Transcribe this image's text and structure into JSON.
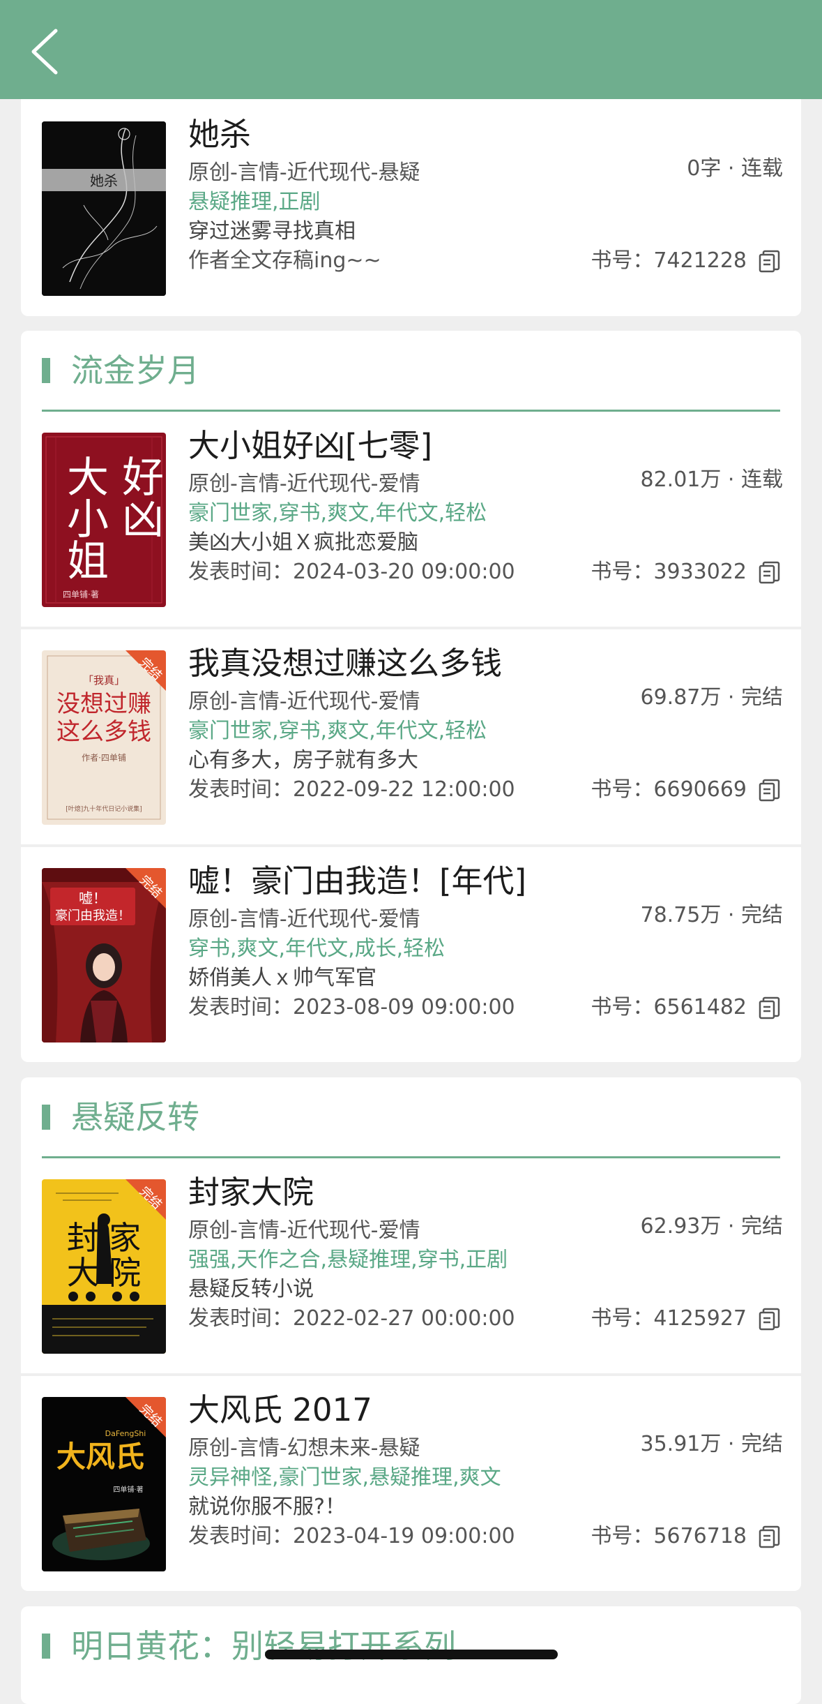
{
  "header": {
    "title": "",
    "back_icon": "chevron-left-icon",
    "bg_color": "#6fae8e"
  },
  "top_book": {
    "title": "她杀",
    "cover_text": "她杀",
    "category": "原创-言情-近代现代-悬疑",
    "meta": "0字 · 连载",
    "tags": "悬疑推理,正剧",
    "intro": "穿过迷雾寻找真相",
    "time": "作者全文存稿ing~~",
    "book_id": "书号：7421228"
  },
  "sections": [
    {
      "title": "流金岁月",
      "books": [
        {
          "title": "大小姐好凶[七零]",
          "category": "原创-言情-近代现代-爱情",
          "meta": "82.01万 · 连载",
          "tags": "豪门世家,穿书,爽文,年代文,轻松",
          "intro": "美凶大小姐Ｘ疯批恋爱脑",
          "time": "发表时间：2024-03-20 09:00:00",
          "book_id": "书号：3933022",
          "cover": {
            "line1": "大 好",
            "line2": "小 凶",
            "line3": "姐",
            "author": "四单铺·著"
          }
        },
        {
          "title": "我真没想过赚这么多钱",
          "category": "原创-言情-近代现代-爱情",
          "meta": "69.87万 · 完结",
          "tags": "豪门世家,穿书,爽文,年代文,轻松",
          "intro": "心有多大，房子就有多大",
          "time": "发表时间：2022-09-22 12:00:00",
          "book_id": "书号：6690669",
          "cover": {
            "top": "「我真」",
            "line1": "没想过赚",
            "line2": "这么多钱",
            "author": "作者·四单铺",
            "bottom": "[叶熄]九十年代日记小说集]",
            "badge": "完结"
          }
        },
        {
          "title": "嘘！豪门由我造！[年代]",
          "category": "原创-言情-近代现代-爱情",
          "meta": "78.75万 · 完结",
          "tags": "穿书,爽文,年代文,成长,轻松",
          "intro": "娇俏美人ｘ帅气军官",
          "time": "发表时间：2023-08-09 09:00:00",
          "book_id": "书号：6561482",
          "cover": {
            "line1": "嘘！",
            "line2": "豪门由我造！",
            "badge": "完结"
          }
        }
      ]
    },
    {
      "title": "悬疑反转",
      "books": [
        {
          "title": "封家大院",
          "category": "原创-言情-近代现代-爱情",
          "meta": "62.93万 · 完结",
          "tags": "强强,天作之合,悬疑推理,穿书,正剧",
          "intro": "悬疑反转小说",
          "time": "发表时间：2022-02-27 00:00:00",
          "book_id": "书号：4125927",
          "cover": {
            "line1": "封 家",
            "line2": "大 院",
            "badge": "完结"
          }
        },
        {
          "title": "大风氏 2017",
          "category": "原创-言情-幻想未来-悬疑",
          "meta": "35.91万 · 完结",
          "tags": "灵异神怪,豪门世家,悬疑推理,爽文",
          "intro": "就说你服不服?！",
          "time": "发表时间：2023-04-19 09:00:00",
          "book_id": "书号：5676718",
          "cover": {
            "small": "DaFengShi",
            "line1": "大风氏",
            "sub": "四单铺·著",
            "badge": "完结"
          }
        }
      ]
    },
    {
      "title": "明日黄花：别轻易打开系列",
      "books": []
    }
  ],
  "colors": {
    "accent": "#6fae8e",
    "tag": "#5aa886",
    "background": "#efefef"
  }
}
